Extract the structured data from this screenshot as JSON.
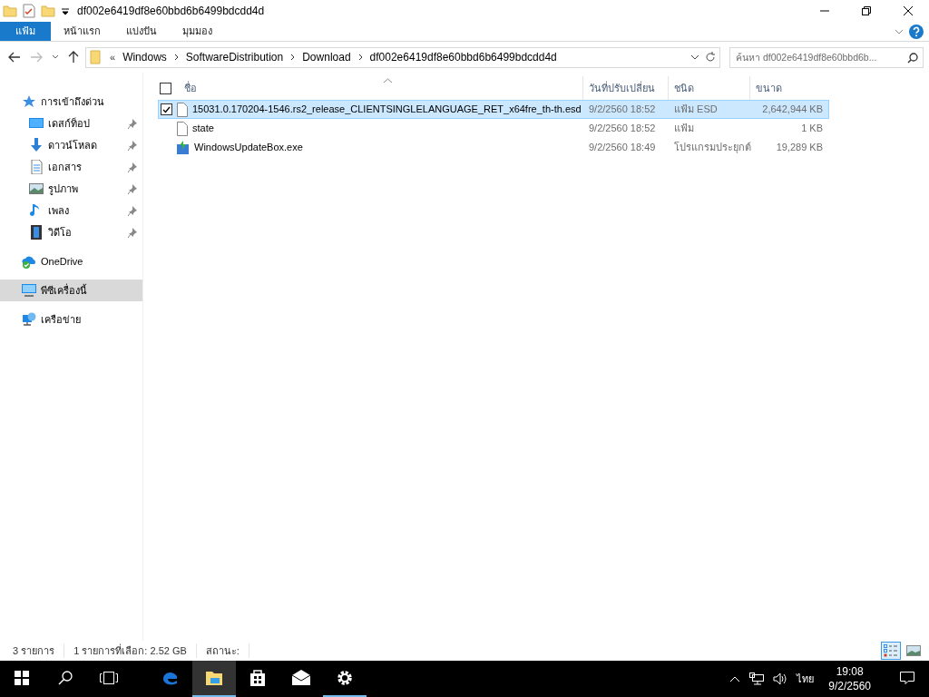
{
  "title_bar": {
    "title": "df002e6419df8e60bbd6b6499bdcdd4d"
  },
  "ribbon_tabs": [
    {
      "label": "แฟ้ม",
      "kind": "file"
    },
    {
      "label": "หน้าแรก",
      "kind": "tab"
    },
    {
      "label": "แบ่งปัน",
      "kind": "tab"
    },
    {
      "label": "มุมมอง",
      "kind": "tab"
    }
  ],
  "address_bar": {
    "overflow": "«",
    "breadcrumbs": [
      "Windows",
      "SoftwareDistribution",
      "Download",
      "df002e6419df8e60bbd6b6499bdcdd4d"
    ]
  },
  "search": {
    "placeholder": "ค้นหา df002e6419df8e60bbd6b..."
  },
  "sidebar": {
    "items": [
      {
        "label": "การเข้าถึงด่วน",
        "kind": "quick",
        "pinned": false,
        "selected": false,
        "children": [
          {
            "label": "เดสก์ท็อป",
            "kind": "desktop",
            "pinned": true,
            "selected": false
          },
          {
            "label": "ดาวน์โหลด",
            "kind": "download",
            "pinned": true,
            "selected": false
          },
          {
            "label": "เอกสาร",
            "kind": "documents",
            "pinned": true,
            "selected": false
          },
          {
            "label": "รูปภาพ",
            "kind": "pictures",
            "pinned": true,
            "selected": false
          },
          {
            "label": "เพลง",
            "kind": "music",
            "pinned": true,
            "selected": false
          },
          {
            "label": "วิดีโอ",
            "kind": "videos",
            "pinned": true,
            "selected": false
          }
        ]
      },
      {
        "label": "OneDrive",
        "kind": "onedrive",
        "pinned": false,
        "selected": false
      },
      {
        "label": "พีซีเครื่องนี้",
        "kind": "pc",
        "pinned": false,
        "selected": true
      },
      {
        "label": "เครือข่าย",
        "kind": "network",
        "pinned": false,
        "selected": false
      }
    ]
  },
  "table": {
    "select_all_checked": false,
    "columns": [
      "ชื่อ",
      "วันที่ปรับเปลี่ยน",
      "ชนิด",
      "ขนาด"
    ],
    "rows": [
      {
        "name": "15031.0.170204-1546.rs2_release_CLIENTSINGLELANGUAGE_RET_x64fre_th-th.esd",
        "date": "9/2/2560 18:52",
        "type": "แฟ้ม ESD",
        "size": "2,642,944 KB",
        "kind": "file",
        "selected": true,
        "checked": true
      },
      {
        "name": "state",
        "date": "9/2/2560 18:52",
        "type": "แฟ้ม",
        "size": "1 KB",
        "kind": "file",
        "selected": false,
        "checked": false
      },
      {
        "name": "WindowsUpdateBox.exe",
        "date": "9/2/2560 18:49",
        "type": "โปรแกรมประยุกต์",
        "size": "19,289 KB",
        "kind": "exe",
        "selected": false,
        "checked": false
      }
    ]
  },
  "status_bar": [
    "3 รายการ",
    "1 รายการที่เลือก: 2.52 GB",
    "สถานะ:"
  ],
  "view_buttons": [
    {
      "kind": "details",
      "selected": true
    },
    {
      "kind": "thumbnails",
      "selected": false
    }
  ],
  "taskbar": {
    "apps": [
      {
        "kind": "edge",
        "active": false,
        "running": false
      },
      {
        "kind": "explorer",
        "active": true,
        "running": true
      },
      {
        "kind": "store",
        "active": false,
        "running": false
      },
      {
        "kind": "mail",
        "active": false,
        "running": false
      },
      {
        "kind": "settings",
        "active": false,
        "running": true
      }
    ],
    "language": "ไทย",
    "time": "19:08",
    "date": "9/2/2560"
  }
}
